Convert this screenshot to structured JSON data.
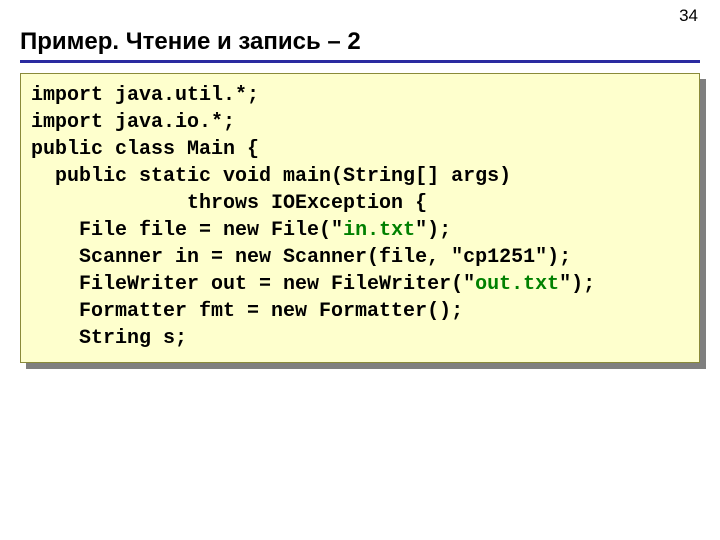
{
  "page_number": "34",
  "title": "Пример. Чтение и запись – 2",
  "code": {
    "l1": "import java.util.*;",
    "l2": "import java.io.*;",
    "l3": "public class Main {",
    "l4": "  public static void main(String[] args)",
    "l5": "             throws IOException {",
    "l6a": "    File file = new File(\"",
    "l6b": "in.txt",
    "l6c": "\");",
    "l7": "    Scanner in = new Scanner(file, \"cp1251\");",
    "l8a": "    FileWriter out = new FileWriter(\"",
    "l8b": "out.txt",
    "l8c": "\");",
    "l9": "    Formatter fmt = new Formatter();",
    "l10": "    String s;"
  }
}
